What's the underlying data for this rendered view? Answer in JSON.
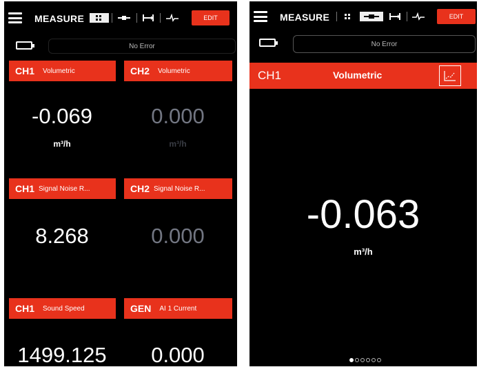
{
  "left_screen": {
    "title": "MEASURE",
    "edit_label": "EDIT",
    "status": "No Error",
    "view_icons": [
      "grid-icon",
      "single-value-icon",
      "pipe-span-icon",
      "waveform-icon"
    ],
    "active_view": "grid-icon",
    "tiles": [
      {
        "channel": "CH1",
        "label": "Volumetric",
        "value": "-0.069",
        "unit": "m³/h",
        "dim": false
      },
      {
        "channel": "CH2",
        "label": "Volumetric",
        "value": "0.000",
        "unit": "m³/h",
        "dim": true
      },
      {
        "channel": "CH1",
        "label": "Signal Noise R...",
        "value": "8.268",
        "unit": "",
        "dim": false
      },
      {
        "channel": "CH2",
        "label": "Signal Noise R...",
        "value": "0.000",
        "unit": "",
        "dim": true
      },
      {
        "channel": "CH1",
        "label": "Sound Speed",
        "value": "1499.125",
        "unit": "",
        "dim": false
      },
      {
        "channel": "GEN",
        "label": "AI 1 Current",
        "value": "0.000",
        "unit": "",
        "dim": false
      }
    ]
  },
  "right_screen": {
    "title": "MEASURE",
    "edit_label": "EDIT",
    "status": "No Error",
    "view_icons": [
      "grid-icon",
      "single-value-icon",
      "pipe-span-icon",
      "waveform-icon"
    ],
    "active_view": "single-value-icon",
    "channel": "CH1",
    "label": "Volumetric",
    "value": "-0.063",
    "unit": "m³/h",
    "page_count": 6,
    "current_page": 1
  },
  "colors": {
    "accent": "#e8321c",
    "background": "#000000",
    "dim_value": "#727682"
  }
}
